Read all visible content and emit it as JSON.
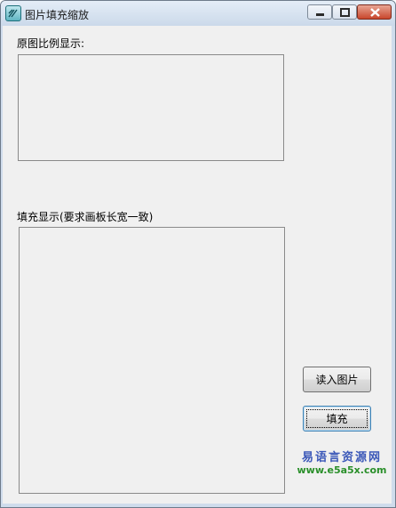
{
  "window": {
    "title": "图片填充缩放"
  },
  "labels": {
    "original": "原图比例显示:",
    "fill": "填充显示(要求画板长宽一致)"
  },
  "buttons": {
    "load": "读入图片",
    "fill": "填充"
  },
  "watermark": {
    "cn": "易语言资源网",
    "url": "www.e5a5x.com"
  },
  "colors": {
    "panel_border": "#8a8a8a",
    "client_bg": "#f0f0f0",
    "titlebar": "#cbd9ea"
  }
}
